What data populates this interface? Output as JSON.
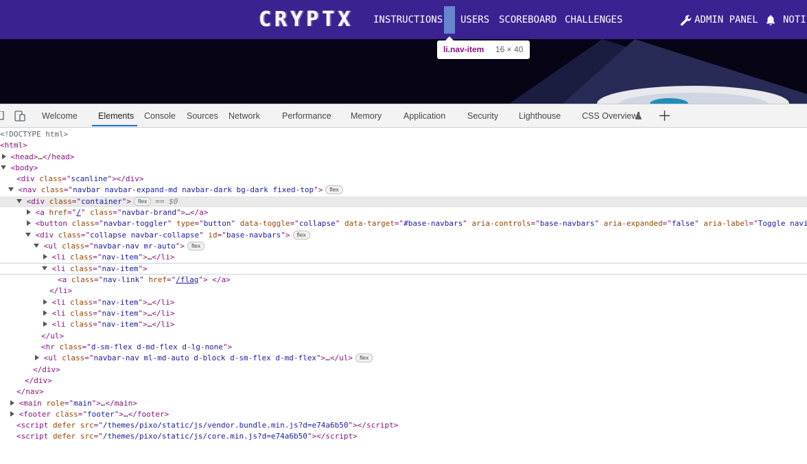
{
  "navbar": {
    "brand": "CRYPTX",
    "items": [
      "INSTRUCTIONS",
      "USERS",
      "SCOREBOARD",
      "CHALLENGES"
    ],
    "admin_panel": "ADMIN PANEL",
    "notifications": "NOTIFI"
  },
  "tooltip": {
    "selector": "li.nav-item",
    "dimensions": "16 × 40"
  },
  "devtools": {
    "tabs": [
      "Welcome",
      "Elements",
      "Console",
      "Sources",
      "Network",
      "Performance",
      "Memory",
      "Application",
      "Security",
      "Lighthouse",
      "CSS Overview"
    ],
    "active_tab": "Elements",
    "dom": {
      "doctype": "<!DOCTYPE html>",
      "html": "html",
      "head": "head",
      "body": "body",
      "scanline_class": "scanline",
      "nav_class": "navbar navbar-expand-md navbar-dark bg-dark fixed-top",
      "container_class": "container",
      "selected_marker": "== $0",
      "brand_href": "/",
      "brand_class": "navbar-brand",
      "toggler_class": "navbar-toggler",
      "toggler_type": "button",
      "toggler_toggle": "collapse",
      "toggler_target": "#base-navbars",
      "toggler_controls": "base-navbars",
      "toggler_expanded": "false",
      "toggler_label": "Toggle navig",
      "collapse_class": "collapse navbar-collapse",
      "collapse_id": "base-navbars",
      "ul1_class": "navbar-nav mr-auto",
      "li_class": "nav-item",
      "link_class": "nav-link",
      "link_href": "/flag",
      "hr_class": "d-sm-flex d-md-flex d-lg-none",
      "ul2_class": "navbar-nav ml-md-auto d-block d-sm-flex d-md-flex",
      "main_role": "main",
      "footer_class": "footer",
      "script1_src": "/themes/pixo/static/js/vendor.bundle.min.js?d=e74a6b50",
      "script2_src": "/themes/pixo/static/js/core.min.js?d=e74a6b50",
      "flex_badge": "flex",
      "ellipsis": "…"
    }
  }
}
